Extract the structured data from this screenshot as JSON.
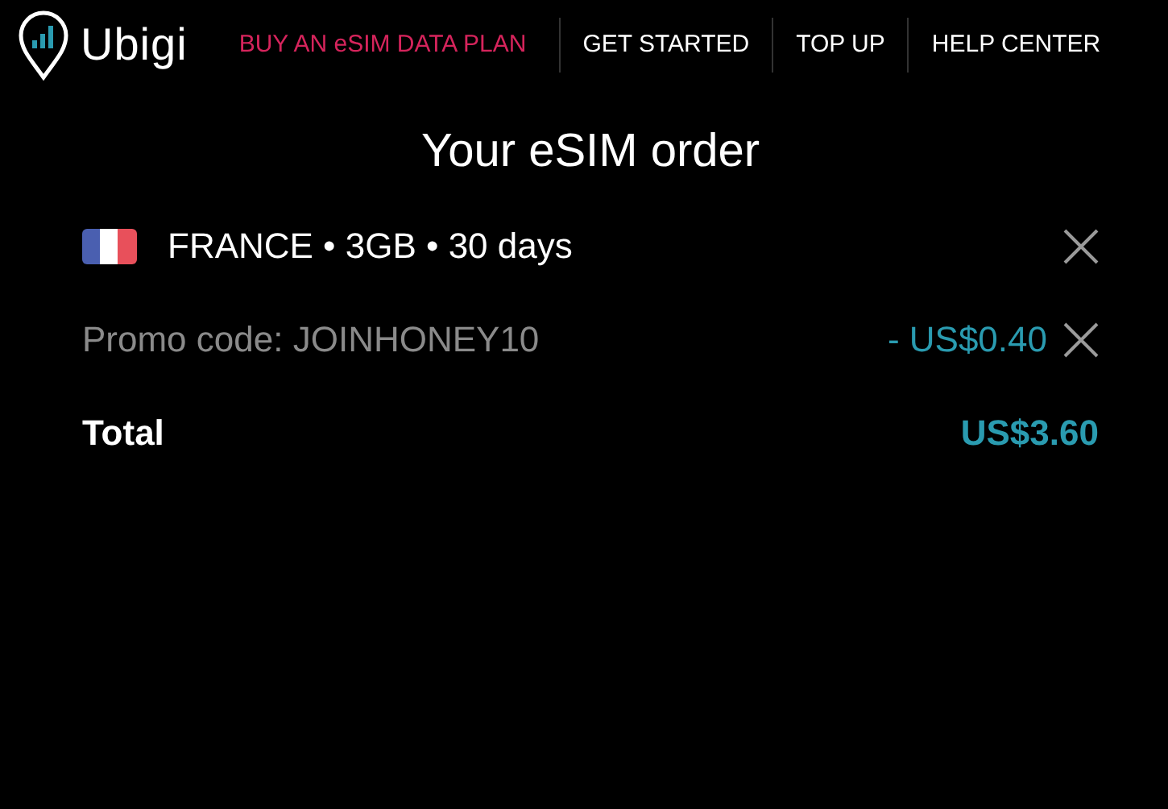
{
  "header": {
    "logo": "Ubigi",
    "nav": [
      {
        "label": "BUY AN eSIM DATA PLAN",
        "selected": true
      },
      {
        "label": "GET STARTED",
        "selected": false
      },
      {
        "label": "TOP UP",
        "selected": false
      },
      {
        "label": "HELP CENTER",
        "selected": false
      }
    ]
  },
  "order": {
    "title": "Your eSIM order",
    "lines": [
      {
        "kind": "plan",
        "label": "FRANCE • 3GB • 30 days"
      },
      {
        "kind": "promo",
        "label": "Promo code: JOINHONEY10",
        "amount": "- US$0.40"
      },
      {
        "kind": "total",
        "label": "Total",
        "amount": "US$3.60"
      }
    ]
  }
}
